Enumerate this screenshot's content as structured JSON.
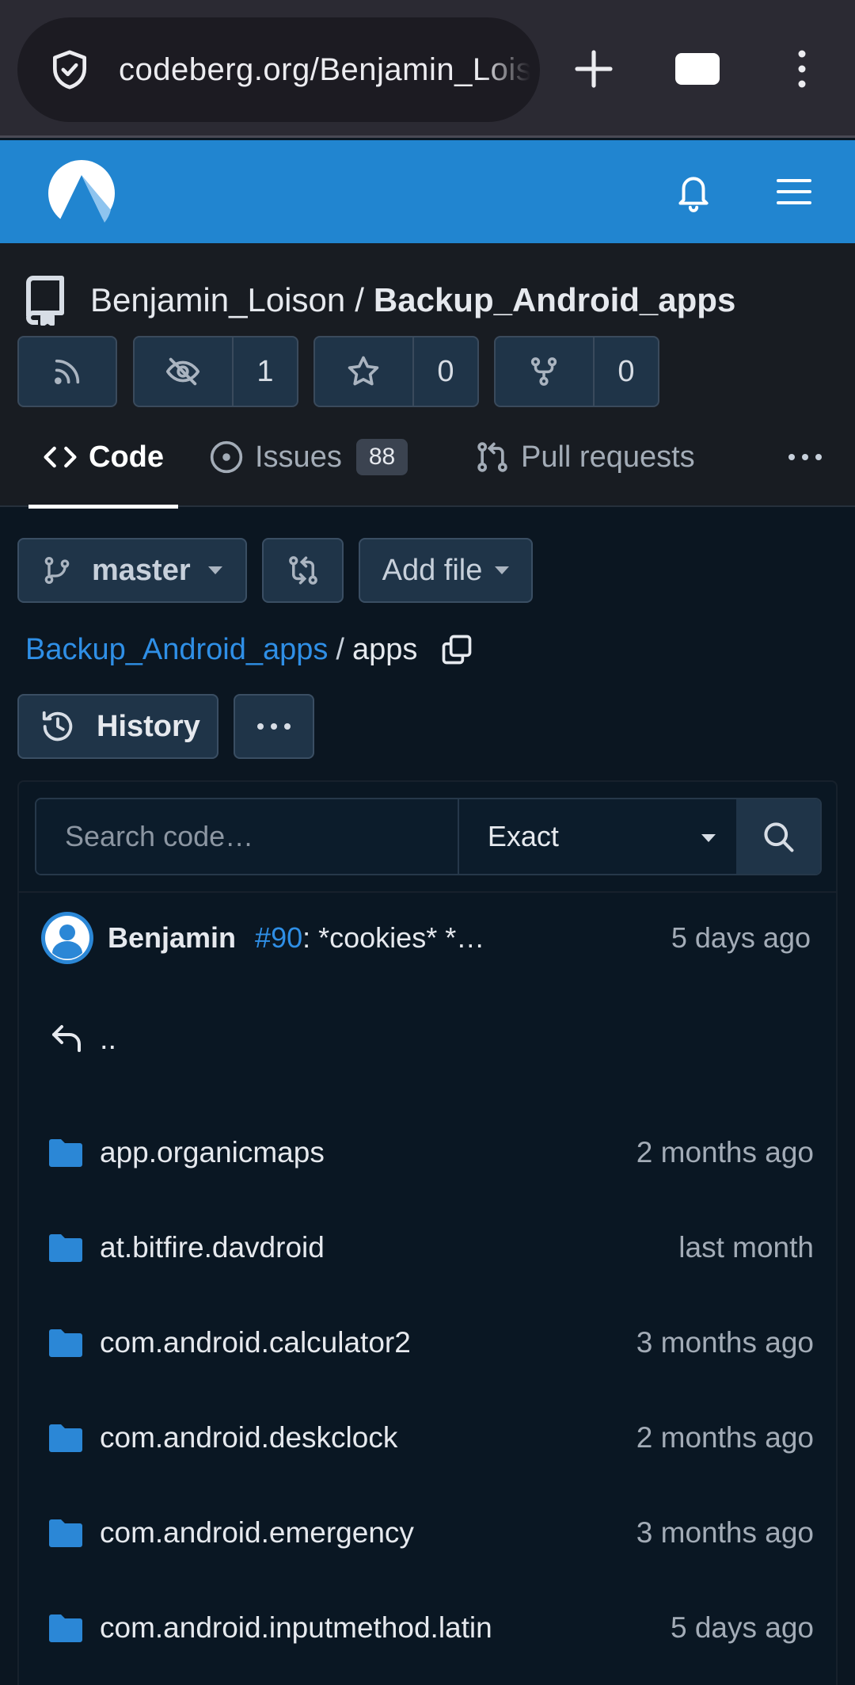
{
  "browser": {
    "url": "codeberg.org/Benjamin_Loison/Backup_Android_apps/src/branch/master/apps"
  },
  "repo": {
    "owner": "Benjamin_Loison",
    "separator": "/",
    "name": "Backup_Android_apps",
    "watchers": "1",
    "stars": "0",
    "forks": "0"
  },
  "tabs": {
    "code": "Code",
    "issues": "Issues",
    "issues_count": "88",
    "pulls": "Pull requests"
  },
  "toolbar": {
    "branch": "master",
    "add_file": "Add file",
    "history": "History"
  },
  "breadcrumb": {
    "root": "Backup_Android_apps",
    "separator": "/",
    "current": "apps"
  },
  "search": {
    "placeholder": "Search code…",
    "mode": "Exact"
  },
  "commit": {
    "author": "Benjamin",
    "ref": "#90",
    "message": ": *cookies* *…",
    "time": "5 days ago"
  },
  "parent_label": "..",
  "files": [
    {
      "name": "app.organicmaps",
      "time": "2 months ago"
    },
    {
      "name": "at.bitfire.davdroid",
      "time": "last month"
    },
    {
      "name": "com.android.calculator2",
      "time": "3 months ago"
    },
    {
      "name": "com.android.deskclock",
      "time": "2 months ago"
    },
    {
      "name": "com.android.emergency",
      "time": "3 months ago"
    },
    {
      "name": "com.android.inputmethod.latin",
      "time": "5 days ago"
    }
  ],
  "colors": {
    "header_blue": "#2185d0",
    "link_blue": "#2f8fe6",
    "folder_blue": "#2b87d6",
    "background": "#0b1621"
  },
  "icons": {
    "browser": [
      "shield-icon",
      "plus-icon",
      "tabs-icon",
      "kebab-icon"
    ],
    "header": [
      "codeberg-logo",
      "bell-icon",
      "hamburger-icon"
    ],
    "repo": [
      "repo-icon",
      "rss-icon",
      "eye-off-icon",
      "star-icon",
      "fork-icon"
    ],
    "tabs": [
      "code-icon",
      "issue-icon",
      "pull-request-icon",
      "more-icon"
    ],
    "toolbar": [
      "branch-icon",
      "compare-icon",
      "copy-icon",
      "history-icon",
      "more-icon"
    ],
    "panel": [
      "search-icon",
      "avatar-icon",
      "reply-icon",
      "folder-icon"
    ]
  }
}
